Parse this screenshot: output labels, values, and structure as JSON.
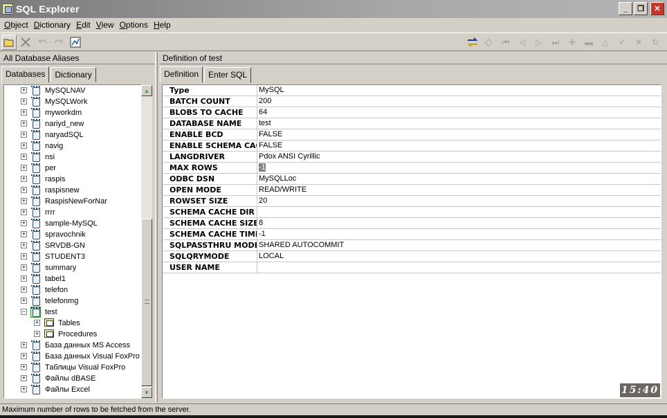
{
  "window": {
    "title": "SQL Explorer",
    "minimize": "_",
    "maximize": "❐",
    "close": "✕"
  },
  "menu": [
    {
      "label": "Object",
      "underline": "O",
      "rest": "bject"
    },
    {
      "label": "Dictionary",
      "underline": "D",
      "rest": "ictionary"
    },
    {
      "label": "Edit",
      "underline": "E",
      "rest": "dit"
    },
    {
      "label": "View",
      "underline": "V",
      "rest": "iew"
    },
    {
      "label": "Options",
      "underline": "O",
      "rest": "ptions"
    },
    {
      "label": "Help",
      "underline": "H",
      "rest": "elp"
    }
  ],
  "left": {
    "header": "All Database Aliases",
    "tabs": [
      "Databases",
      "Dictionary"
    ],
    "tree": [
      {
        "label": "MySQLNAV",
        "level": 0,
        "type": "db"
      },
      {
        "label": "MySQLWork",
        "level": 0,
        "type": "db"
      },
      {
        "label": "myworkdm",
        "level": 0,
        "type": "db"
      },
      {
        "label": "nariyd_new",
        "level": 0,
        "type": "db"
      },
      {
        "label": "naryadSQL",
        "level": 0,
        "type": "db"
      },
      {
        "label": "navig",
        "level": 0,
        "type": "db"
      },
      {
        "label": "nsi",
        "level": 0,
        "type": "db"
      },
      {
        "label": "per",
        "level": 0,
        "type": "db"
      },
      {
        "label": "raspis",
        "level": 0,
        "type": "db"
      },
      {
        "label": "raspisnew",
        "level": 0,
        "type": "db"
      },
      {
        "label": "RaspisNewForNar",
        "level": 0,
        "type": "db"
      },
      {
        "label": "rrrr",
        "level": 0,
        "type": "db"
      },
      {
        "label": "sample-MySQL",
        "level": 0,
        "type": "db"
      },
      {
        "label": "spravochnik",
        "level": 0,
        "type": "db"
      },
      {
        "label": "SRVDB-GN",
        "level": 0,
        "type": "db"
      },
      {
        "label": "STUDENT3",
        "level": 0,
        "type": "db"
      },
      {
        "label": "summary",
        "level": 0,
        "type": "db"
      },
      {
        "label": "tabel1",
        "level": 0,
        "type": "db"
      },
      {
        "label": "telefon",
        "level": 0,
        "type": "db"
      },
      {
        "label": "telefonmg",
        "level": 0,
        "type": "db"
      },
      {
        "label": "test",
        "level": 0,
        "type": "db-open"
      },
      {
        "label": "Tables",
        "level": 1,
        "type": "folder"
      },
      {
        "label": "Procedures",
        "level": 1,
        "type": "folder"
      },
      {
        "label": "База данных MS Access",
        "level": 0,
        "type": "db"
      },
      {
        "label": "База данных Visual FoxPro",
        "level": 0,
        "type": "db"
      },
      {
        "label": "Таблицы Visual FoxPro",
        "level": 0,
        "type": "db"
      },
      {
        "label": "Файлы dBASE",
        "level": 0,
        "type": "db"
      },
      {
        "label": "Файлы Excel",
        "level": 0,
        "type": "db"
      }
    ]
  },
  "right": {
    "header": "Definition of test",
    "tabs": [
      "Definition",
      "Enter SQL"
    ],
    "rows": [
      {
        "key": "Type",
        "value": "MySQL"
      },
      {
        "key": "BATCH COUNT",
        "value": "200"
      },
      {
        "key": "BLOBS TO CACHE",
        "value": "64"
      },
      {
        "key": "DATABASE NAME",
        "value": "test"
      },
      {
        "key": "ENABLE BCD",
        "value": "FALSE"
      },
      {
        "key": "ENABLE SCHEMA CACHE",
        "value": "FALSE"
      },
      {
        "key": "LANGDRIVER",
        "value": "Pdox ANSI Cyrillic"
      },
      {
        "key": "MAX ROWS",
        "value": "-1",
        "selected": true
      },
      {
        "key": "ODBC DSN",
        "value": "MySQLLoc"
      },
      {
        "key": "OPEN MODE",
        "value": "READ/WRITE"
      },
      {
        "key": "ROWSET SIZE",
        "value": "20"
      },
      {
        "key": "SCHEMA CACHE DIR",
        "value": ""
      },
      {
        "key": "SCHEMA CACHE SIZE",
        "value": "8"
      },
      {
        "key": "SCHEMA CACHE TIME",
        "value": "-1"
      },
      {
        "key": "SQLPASSTHRU MODE",
        "value": "SHARED AUTOCOMMIT"
      },
      {
        "key": "SQLQRYMODE",
        "value": "LOCAL"
      },
      {
        "key": "USER NAME",
        "value": ""
      }
    ]
  },
  "clock": "15:40",
  "status": "Maximum number of rows to be fetched from the server.",
  "icons": {
    "tree_expander_collapsed": "+",
    "tree_expander_expanded": "−",
    "scroll_up": "▲",
    "scroll_down": "▼"
  }
}
